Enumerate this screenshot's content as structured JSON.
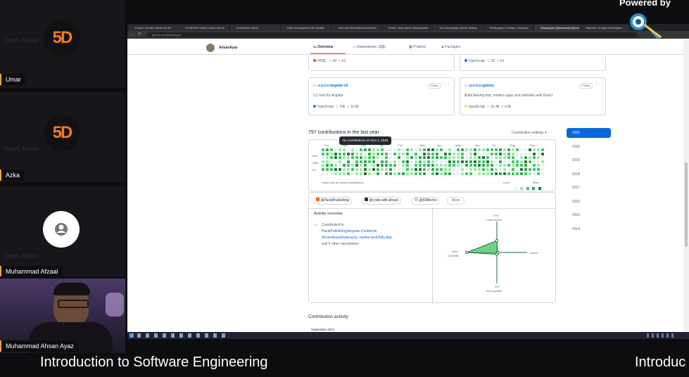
{
  "participants": [
    {
      "name": "Umar",
      "logo_text": "5D",
      "ghost_text": "Team More"
    },
    {
      "name": "Azka",
      "logo_text": "5D",
      "ghost_text": "Team More"
    },
    {
      "name": "Muhammad Afzaal",
      "ghost_text": "Team More"
    },
    {
      "name": "Muhammad Ahsan Ayaz"
    }
  ],
  "branding": {
    "powered_by": "Powered by",
    "streamyard": "StreamYard"
  },
  "browser": {
    "tabs": [
      "Proven Growth Hacks for SE",
      "CS MOOK Stack Crash Course",
      "Livestream Client",
      "Web Development 3D Models",
      "Jobs and Recruitment services",
      "Freed - Ads launch Marketplace",
      "The messaging tool for finding",
      "Photograph | Scrape | Develop",
      "AhsanAyaz (Muhammad Ahsan",
      "Reports | Google Developers"
    ],
    "url": "github.com/AhsanAyaz"
  },
  "github": {
    "username": "AhsanAyaz",
    "nav": {
      "overview": "Overview",
      "repositories": "Repositories",
      "repo_count": "126",
      "projects": "Projects",
      "packages": "Packages"
    },
    "top_repos": [
      {
        "lang": "HTML",
        "lang_color": "#e34c26",
        "stars": "34",
        "forks": "10"
      },
      {
        "lang": "TypeScript",
        "lang_color": "#3178c6",
        "stars": "25",
        "forks": "10"
      }
    ],
    "repos": [
      {
        "owner": "angular/",
        "name": "angular-cli",
        "desc": "CLI tool for Angular",
        "lang": "TypeScript",
        "lang_color": "#3178c6",
        "stars": "23k",
        "forks": "11.6k",
        "visibility": "Public"
      },
      {
        "owner": "gatsbyjs/",
        "name": "gatsby",
        "desc": "Build blazing fast, modern apps and websites with React",
        "lang": "JavaScript",
        "lang_color": "#f1e05a",
        "stars": "51.4k",
        "forks": "9.8k",
        "visibility": "Public"
      }
    ],
    "contrib_title": "797 contributions in the last year",
    "contrib_settings": "Contribution settings ▾",
    "tooltip": "No contributions on Nov 1, 2020",
    "months": [
      "Oct",
      "Nov",
      "Dec",
      "Jan",
      "Feb",
      "Mar",
      "Apr",
      "May",
      "Jun",
      "Jul",
      "Aug",
      "Sep"
    ],
    "days": [
      "Mon",
      "Wed",
      "Fri"
    ],
    "learn_more": "Learn how we count contributions",
    "less": "Less",
    "more": "More",
    "years": [
      "2021",
      "2020",
      "2019",
      "2018",
      "2017",
      "2016",
      "2015",
      "2014"
    ],
    "orgs": [
      "@PacktPublishing",
      "@code-with-ahsan",
      "@IOMechs"
    ],
    "orgs_more": "More",
    "activity_title": "Activity overview",
    "contributed_to": "Contributed to",
    "contrib_repos": [
      "PacktPublishing/Angular-Cookbook,",
      "AhsanAyaz/ahsanayaz, naxtes-tech/lotty.App"
    ],
    "other_repos": "and 5 other repositories",
    "radar": {
      "code_review_pct": "27%",
      "code_review": "Code review",
      "commits_pct": "69%",
      "commits": "Commits",
      "issues": "Issues",
      "pull_requests_pct": "4%",
      "pull_requests": "Pull requests",
      "values": {
        "code_review": 27,
        "commits": 69,
        "issues": 0,
        "pull_requests": 4
      }
    },
    "activity_heading": "Contribution activity",
    "activity_month": "September 2021"
  },
  "caption": {
    "main": "Introduction to Software Engineering",
    "overflow": "Introduc"
  }
}
